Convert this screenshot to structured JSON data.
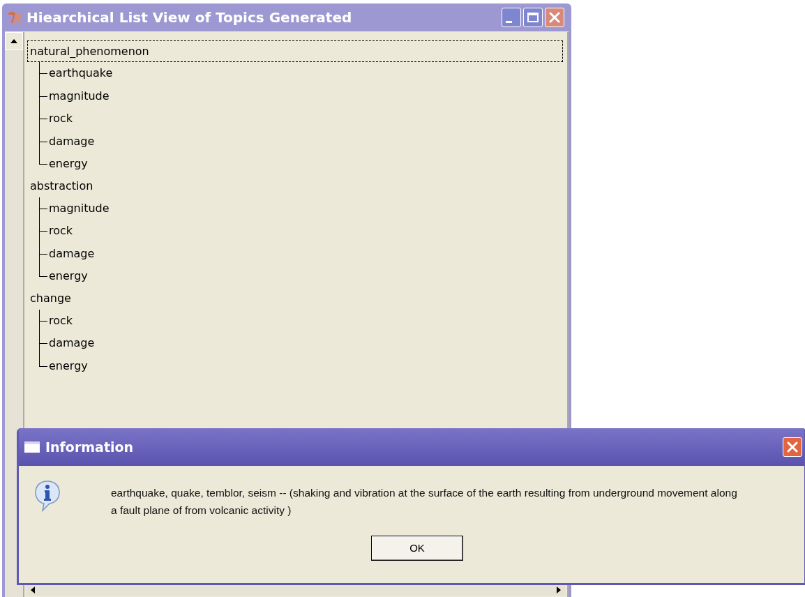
{
  "window": {
    "title": "Hiearchical List View of Topics Generated"
  },
  "tree": [
    {
      "label": "natural_phenomenon",
      "selected": true,
      "children": [
        {
          "label": "earthquake"
        },
        {
          "label": "magnitude"
        },
        {
          "label": "rock"
        },
        {
          "label": "damage"
        },
        {
          "label": "energy"
        }
      ]
    },
    {
      "label": "abstraction",
      "selected": false,
      "children": [
        {
          "label": "magnitude"
        },
        {
          "label": "rock"
        },
        {
          "label": "damage"
        },
        {
          "label": "energy"
        }
      ]
    },
    {
      "label": "change",
      "selected": false,
      "children": [
        {
          "label": "rock"
        },
        {
          "label": "damage"
        },
        {
          "label": "energy"
        }
      ]
    }
  ],
  "dialog": {
    "title": "Information",
    "message": "earthquake, quake, temblor, seism -- (shaking and vibration at the surface of the earth resulting from underground movement along a fault plane of from volcanic activity  )",
    "buttons": [
      "OK"
    ]
  }
}
